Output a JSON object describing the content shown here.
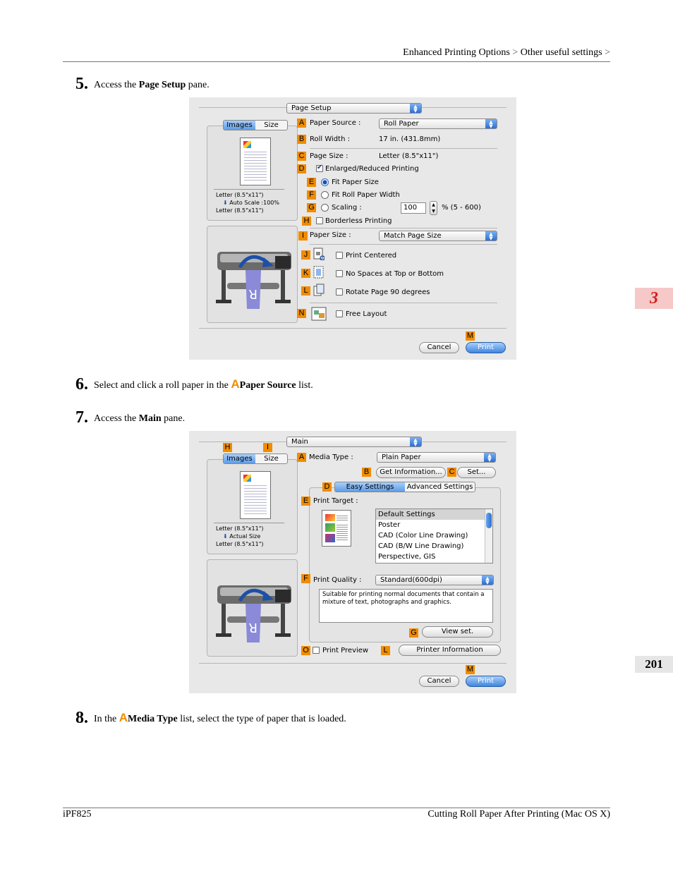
{
  "header": {
    "breadcrumb_1": "Enhanced Printing Options",
    "separator": ">",
    "breadcrumb_2": "Other useful settings",
    "trailing": ">"
  },
  "side_tab": {
    "chapter": "3",
    "page": "201"
  },
  "steps": [
    {
      "num": "5.",
      "pre": "Access the ",
      "bold": "Page Setup",
      "post": " pane."
    },
    {
      "num": "6.",
      "pre": "Select and click a roll paper in the ",
      "letter": "A",
      "bold": "Paper Source",
      "post": " list."
    },
    {
      "num": "7.",
      "pre": "Access the ",
      "bold": "Main",
      "post": " pane."
    },
    {
      "num": "8.",
      "pre": "In the ",
      "letter": "A",
      "bold": "Media Type",
      "post": " list, select the type of paper that is loaded."
    }
  ],
  "dialog1": {
    "pane_popup": "Page Setup",
    "tabs": [
      "Images",
      "Size"
    ],
    "preview_text": [
      "Letter (8.5\"x11\")",
      "Auto Scale :100%",
      "Letter (8.5\"x11\")"
    ],
    "preview_arrow": "⬇",
    "letters": [
      "A",
      "B",
      "C",
      "D",
      "E",
      "F",
      "G",
      "H",
      "I",
      "J",
      "K",
      "L",
      "N",
      "M"
    ],
    "paper_source_label": "Paper Source :",
    "paper_source_value": "Roll Paper",
    "roll_width_label": "Roll Width :",
    "roll_width_value": "17 in. (431.8mm)",
    "page_size_label": "Page Size :",
    "page_size_value": "Letter (8.5\"x11\")",
    "enlarged_label": "Enlarged/Reduced Printing",
    "fit_paper_size": "Fit Paper Size",
    "fit_roll_width": "Fit Roll Paper Width",
    "scaling_label": "Scaling :",
    "scaling_value": "100",
    "scaling_range": "% (5 - 600)",
    "borderless": "Borderless Printing",
    "paper_size_label": "Paper Size :",
    "paper_size_value": "Match Page Size",
    "print_centered": "Print Centered",
    "no_spaces": "No Spaces at Top or Bottom",
    "rotate": "Rotate Page 90 degrees",
    "free_layout": "Free Layout",
    "cancel": "Cancel",
    "print": "Print"
  },
  "dialog2": {
    "pane_popup": "Main",
    "tabs": [
      "Images",
      "Size"
    ],
    "preview_text": [
      "Letter (8.5\"x11\")",
      "Actual Size",
      "Letter (8.5\"x11\")"
    ],
    "preview_arrow": "⬇",
    "letters": [
      "H",
      "I",
      "A",
      "B",
      "C",
      "D",
      "E",
      "F",
      "G",
      "O",
      "L",
      "M"
    ],
    "media_type_label": "Media Type :",
    "media_type_value": "Plain Paper",
    "get_info": "Get Information...",
    "set": "Set...",
    "seg_tabs": [
      "Easy Settings",
      "Advanced Settings"
    ],
    "print_target_label": "Print Target :",
    "print_target_items": [
      "Default Settings",
      "Poster",
      "CAD (Color Line Drawing)",
      "CAD (B/W Line Drawing)",
      "Perspective, GIS"
    ],
    "print_quality_label": "Print Quality :",
    "print_quality_value": "Standard(600dpi)",
    "quality_desc": "Suitable for printing normal documents that contain a mixture of text, photographs and graphics.",
    "view_set": "View set.",
    "print_preview": "Print Preview",
    "printer_info": "Printer Information",
    "cancel": "Cancel",
    "print": "Print"
  },
  "footer": {
    "model": "iPF825",
    "title": "Cutting Roll Paper After Printing (Mac OS X)"
  }
}
